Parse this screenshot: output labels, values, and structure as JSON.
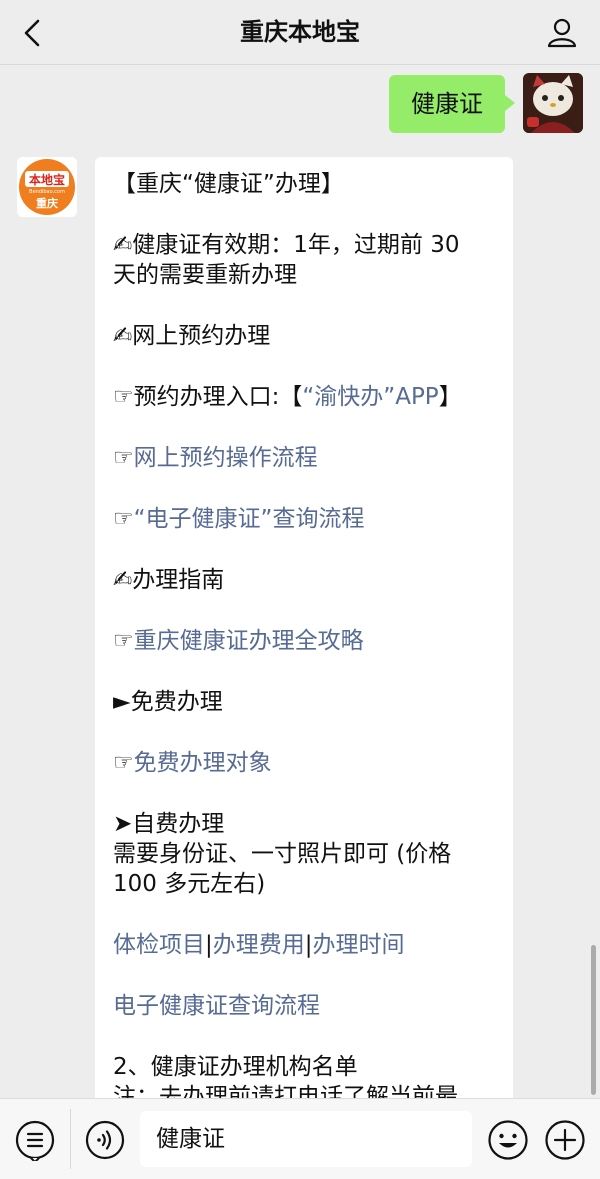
{
  "header": {
    "title": "重庆本地宝"
  },
  "icons": {
    "back": "chevron-left-icon",
    "profile": "person-icon",
    "menu": "menu-list-icon",
    "voice": "voice-icon",
    "emoji": "emoji-icon",
    "plus": "plus-icon"
  },
  "chat": {
    "sent_message": "健康证",
    "bot_avatar": {
      "logo_text": "本地宝",
      "logo_sub": "Bendibao.com",
      "city": "重庆"
    },
    "reply": {
      "title": "【重庆“健康证”办理】",
      "validity_line1": "✍健康证有效期：1年，过期前 30",
      "validity_line2": "天的需要重新办理",
      "online_heading": "✍网上预约办理",
      "entry_prefix": "☞预约办理入口:【",
      "entry_link": "“渝快办”APP",
      "entry_suffix": "】",
      "flow_prefix": "☞",
      "flow_link": "网上预约操作流程",
      "ehealth_prefix": "☞",
      "ehealth_link": "“电子健康证”查询流程",
      "guide_heading": "✍办理指南",
      "guide_prefix": "☞",
      "guide_link": "重庆健康证办理全攻略",
      "free_heading": "►免费办理",
      "free_prefix": "☞",
      "free_link": "免费办理对象",
      "paid_heading": "➤自费办理",
      "paid_line1": "需要身份证、一寸照片即可 (价格",
      "paid_line2": "100 多元左右)",
      "link_items": "体检项目",
      "link_fee": "办理费用",
      "link_time": "办理时间",
      "separator": "|",
      "ehealth_query": "电子健康证查询流程",
      "org_list": "2、健康证办理机构名单",
      "note_partial": "注：去办理前请打电话了解当前最"
    }
  },
  "input": {
    "value": "健康证"
  },
  "colors": {
    "background": "#ededed",
    "sent_bubble": "#95ec69",
    "link": "#576b95",
    "logo_orange": "#f07d1e"
  }
}
